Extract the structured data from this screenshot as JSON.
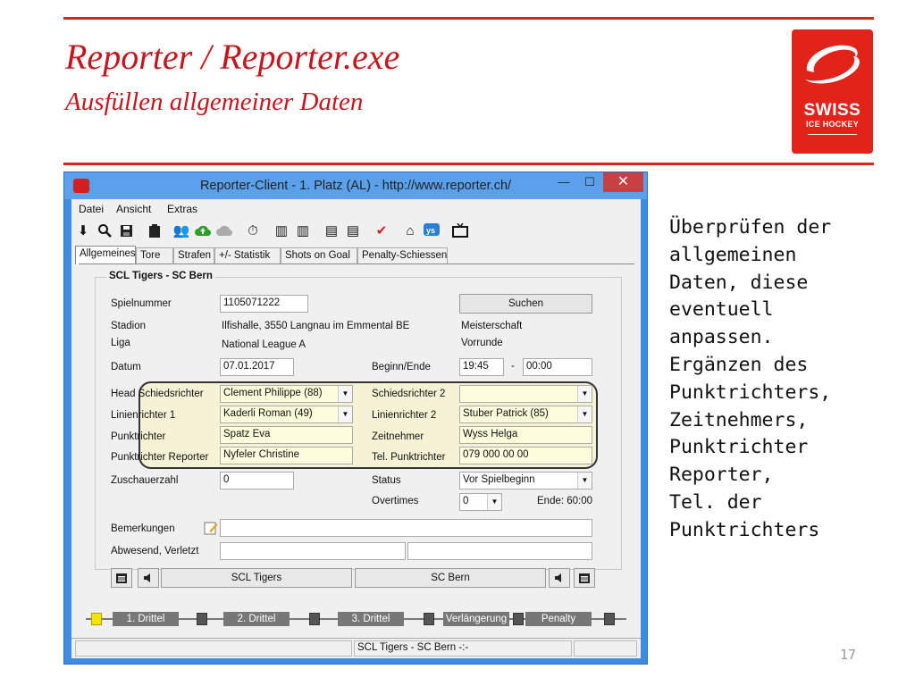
{
  "slide": {
    "title": "Reporter / Reporter.exe",
    "subtitle": "Ausfüllen allgemeiner Daten",
    "note": "Überprüfen der\nallgemeinen\nDaten, diese\neventuell\nanpassen.\nErgänzen des\nPunktrichters,\nZeitnehmers,\nPunktrichter\nReporter,\nTel. der\nPunktrichters",
    "page_number": "17",
    "brand_color": "#e2231a",
    "logo": {
      "line1": "SWISS",
      "line2": "ICE HOCKEY"
    }
  },
  "window": {
    "title": "Reporter-Client  -  1. Platz (AL)  -  http://www.reporter.ch/",
    "minimize": "—",
    "maximize": "☐",
    "close": "✕"
  },
  "menu": [
    "Datei",
    "Ansicht",
    "Extras"
  ],
  "toolbar_icons": [
    "download-icon",
    "search-icon",
    "save-icon",
    "clipboard-icon",
    "players-icon",
    "upload-icon",
    "cloud-icon",
    "stopwatch-icon",
    "lineup-icon",
    "lineup-icon",
    "referee-icon",
    "referee-icon",
    "checkmark-icon",
    "home-icon",
    "yes-icon",
    "tv-icon"
  ],
  "tabs": [
    "Allgemeines",
    "Tore",
    "Strafen",
    "+/- Statistik",
    "Shots on Goal",
    "Penalty-Schiessen"
  ],
  "form": {
    "group_title": "SCL Tigers - SC Bern",
    "spielnummer_label": "Spielnummer",
    "spielnummer": "1105071222",
    "suchen": "Suchen",
    "stadion_label": "Stadion",
    "stadion": "Ilfishalle, 3550 Langnau im Emmental BE",
    "meisterschaft": "Meisterschaft",
    "liga_label": "Liga",
    "liga": "National League A",
    "vorrunde": "Vorrunde",
    "datum_label": "Datum",
    "datum": "07.01.2017",
    "beginn_label": "Beginn/Ende",
    "beginn": "19:45",
    "dash": "-",
    "ende": "00:00",
    "head_sr_label": "Head Schiedsrichter",
    "head_sr": "Clement Philippe (88)",
    "sr2_label": "Schiedsrichter 2",
    "sr2": "",
    "lr1_label": "Linienrichter 1",
    "lr1": "Kaderli Roman (49)",
    "lr2_label": "Linienrichter 2",
    "lr2": "Stuber Patrick (85)",
    "punktrichter_label": "Punktrichter",
    "punktrichter": "Spatz Eva",
    "zeitnehmer_label": "Zeitnehmer",
    "zeitnehmer": "Wyss Helga",
    "pr_reporter_label": "Punktrichter Reporter",
    "pr_reporter": "Nyfeler Christine",
    "tel_label": "Tel. Punktrichter",
    "tel": "079 000 00 00",
    "zuschauer_label": "Zuschauerzahl",
    "zuschauer": "0",
    "status_label": "Status",
    "status": "Vor Spielbeginn",
    "overtimes_label": "Overtimes",
    "overtimes": "0",
    "ende_info": "Ende: 60:00",
    "bemerkungen_label": "Bemerkungen",
    "bemerkungen": "",
    "abwesend_label": "Abwesend, Verletzt",
    "abwesend_home": "",
    "abwesend_away": ""
  },
  "teams": {
    "home": "SCL Tigers",
    "away": "SC Bern"
  },
  "timeline": [
    "1. Drittel",
    "2. Drittel",
    "3. Drittel",
    "Verlängerung",
    "Penalty"
  ],
  "status_bar": {
    "score": "SCL Tigers - SC Bern -:-"
  }
}
